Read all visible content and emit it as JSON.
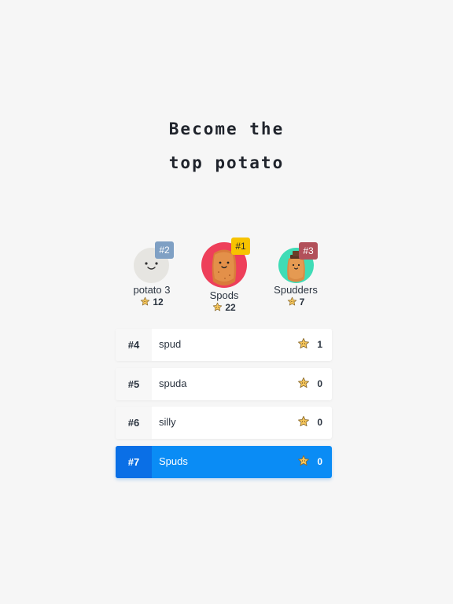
{
  "headline": {
    "line1": "Become the",
    "line2": "top potato"
  },
  "podium": {
    "second": {
      "rank": "#2",
      "name": "potato 3",
      "score": "12",
      "avatar": "smiley-face-icon",
      "ring_color": "#e6e5e1",
      "badge_color": "#7fa0c4"
    },
    "first": {
      "rank": "#1",
      "name": "Spods",
      "score": "22",
      "avatar": "potato-avatar",
      "ring_color": "#ee3f5a",
      "badge_color": "#f7c300"
    },
    "third": {
      "rank": "#3",
      "name": "Spudders",
      "score": "7",
      "avatar": "potato-with-hat-avatar",
      "ring_color": "#3fdcb6",
      "badge_color": "#b2505a"
    }
  },
  "leaderboard": [
    {
      "rank": "#4",
      "name": "spud",
      "score": "1"
    },
    {
      "rank": "#5",
      "name": "spuda",
      "score": "0"
    },
    {
      "rank": "#6",
      "name": "silly",
      "score": "0"
    },
    {
      "rank": "#7",
      "name": "Spuds",
      "score": "0",
      "current_user": true
    }
  ],
  "colors": {
    "background": "#f6f6f6",
    "highlight": "#0a8cf5",
    "highlight_rank": "#0a6fe6",
    "star": "#f6c65b"
  }
}
